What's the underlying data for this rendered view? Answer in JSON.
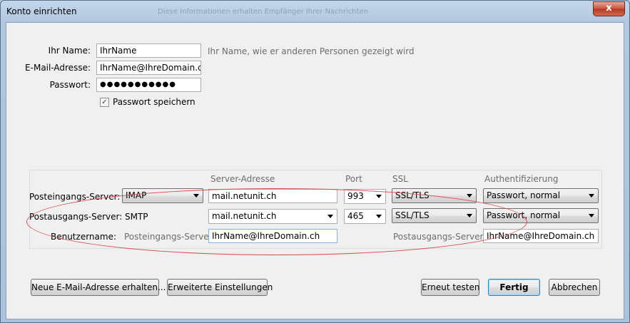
{
  "window": {
    "title": "Konto einrichten",
    "ghost_title": "Diese Informationen erhalten Empfänger Ihrer Nachrichten",
    "close_glyph": "x"
  },
  "account": {
    "name_label": "Ihr Name:",
    "name_value": "IhrName",
    "name_hint": "Ihr Name, wie er anderen Personen gezeigt wird",
    "email_label": "E-Mail-Adresse:",
    "email_value": "IhrName@IhreDomain.ch",
    "password_label": "Passwort:",
    "password_value": "●●●●●●●●●●●",
    "save_password_label": "Passwort speichern",
    "save_password_checked": true
  },
  "server": {
    "col_address": "Server-Adresse",
    "col_port": "Port",
    "col_ssl": "SSL",
    "col_auth": "Authentifizierung",
    "incoming": {
      "label": "Posteingangs-Server:",
      "protocol": "IMAP",
      "address": "mail.netunit.ch",
      "port": "993",
      "ssl": "SSL/TLS",
      "auth": "Passwort, normal"
    },
    "outgoing": {
      "label": "Postausgangs-Server:",
      "protocol": "SMTP",
      "address": "mail.netunit.ch",
      "port": "465",
      "ssl": "SSL/TLS",
      "auth": "Passwort, normal"
    },
    "username": {
      "label": "Benutzername:",
      "incoming_label": "Posteingangs-Server:",
      "incoming_value": "IhrName@IhreDomain.ch",
      "outgoing_label": "Postausgangs-Server:",
      "outgoing_value": "IhrName@IhreDomain.ch"
    }
  },
  "buttons": {
    "new_address": "Neue E-Mail-Adresse erhalten...",
    "advanced": "Erweiterte Einstellungen",
    "retest": "Erneut testen",
    "done": "Fertig",
    "cancel": "Abbrechen"
  },
  "colors": {
    "annotation_oval": "#d94a4a"
  }
}
